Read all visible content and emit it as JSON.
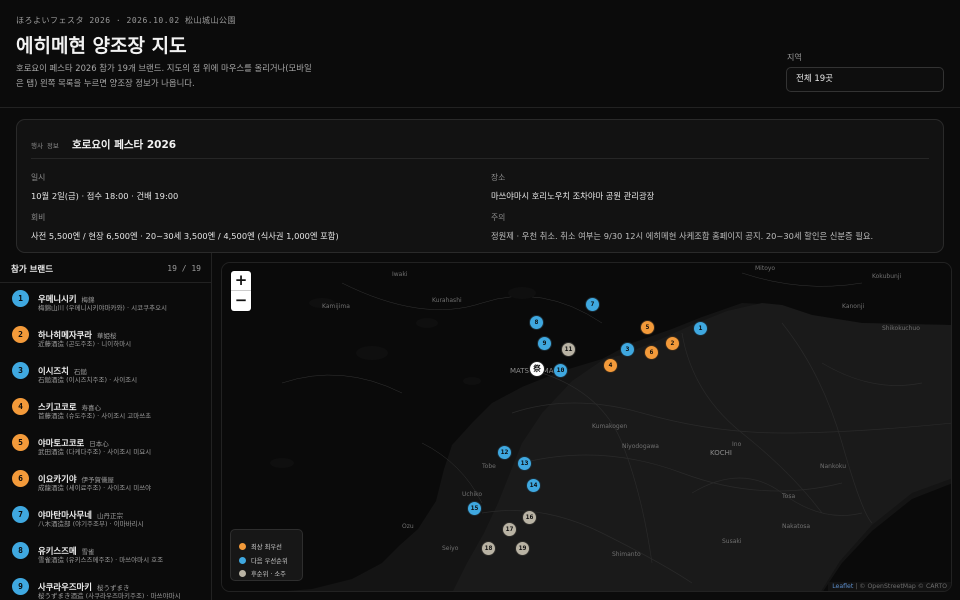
{
  "header": {
    "eyebrow": "ほろよいフェスタ 2026 · 2026.10.02 松山城山公園",
    "title": "에히메현 양조장 지도",
    "subtitle": "호로요이 페스타 2026 참가 19개 브랜드. 지도의 점 위에 마우스를 올리거나(모바일은 탭) 왼쪽 목록을 누르면 양조장 정보가 나옵니다.",
    "region_label": "지역",
    "region_value": "전체 19곳"
  },
  "event": {
    "kicker": "행사 정보",
    "title": "호로요이 페스타 2026",
    "fields": [
      {
        "label": "일시",
        "value": "10월 2일(금) · 접수 18:00 · 건배 19:00"
      },
      {
        "label": "장소",
        "value": "마쓰야마시 호리노우치 조차야마 공원 관리광장"
      },
      {
        "label": "회비",
        "value": "사전 5,500엔 / 현장 6,500엔 · 20~30세 3,500엔 / 4,500엔 (식사권 1,000엔 포함)"
      },
      {
        "label": "주의",
        "value": "정원제 · 우천 취소. 취소 여부는 9/30 12시 에히메현 사케조합 홈페이지 공지. 20~30세 할인은 신분증 필요."
      }
    ]
  },
  "sidebar": {
    "title": "참가 브랜드",
    "count": "19 / 19",
    "brands": [
      {
        "num": "1",
        "name": "우메니시키",
        "jp": "梅錦",
        "detail": "梅錦山川 (우메니시키야마카와) · 시코쿠추오시",
        "group": "blue"
      },
      {
        "num": "2",
        "name": "하나히메자쿠라",
        "jp": "華姫桜",
        "detail": "近藤酒造 (곤도주조) · 니이하마시",
        "group": "orange"
      },
      {
        "num": "3",
        "name": "이시즈치",
        "jp": "石鎚",
        "detail": "石鎚酒造 (이시즈치주조) · 사이조시",
        "group": "blue"
      },
      {
        "num": "4",
        "name": "스키고코로",
        "jp": "寿喜心",
        "detail": "首藤酒造 (슈도주조) · 사이조시 고마쓰초",
        "group": "orange"
      },
      {
        "num": "5",
        "name": "야마토고코로",
        "jp": "日本心",
        "detail": "武田酒造 (다케다주조) · 사이조시 미요시",
        "group": "orange"
      },
      {
        "num": "6",
        "name": "이요카기야",
        "jp": "伊予賀儀屋",
        "detail": "成龍酒造 (세이료주조) · 사이조시 미쓰야",
        "group": "orange"
      },
      {
        "num": "7",
        "name": "야마탄마사무네",
        "jp": "山丹正宗",
        "detail": "八木酒造部 (야기주조부) · 이마바리시",
        "group": "blue"
      },
      {
        "num": "8",
        "name": "유키스즈메",
        "jp": "雪雀",
        "detail": "雪雀酒造 (유키스즈메주조) · 마쓰야마시 호조",
        "group": "blue"
      },
      {
        "num": "9",
        "name": "사쿠라우즈마키",
        "jp": "桜うずまき",
        "detail": "桜うずまき酒造 (사쿠라우즈마키주조) · 마쓰야마시",
        "group": "blue"
      }
    ]
  },
  "map": {
    "zoom_in": "+",
    "zoom_out": "−",
    "venue_label": "祭",
    "colors": {
      "orange": "#f39a3a",
      "blue": "#3fa8e0",
      "gray": "#b9b3a4"
    },
    "markers": [
      {
        "num": "1",
        "group": "blue"
      },
      {
        "num": "2",
        "group": "orange"
      },
      {
        "num": "3",
        "group": "blue"
      },
      {
        "num": "4",
        "group": "orange"
      },
      {
        "num": "5",
        "group": "orange"
      },
      {
        "num": "6",
        "group": "orange"
      },
      {
        "num": "7",
        "group": "blue"
      },
      {
        "num": "8",
        "group": "blue"
      },
      {
        "num": "9",
        "group": "blue"
      },
      {
        "num": "10",
        "group": "blue"
      },
      {
        "num": "11",
        "group": "gray"
      },
      {
        "num": "12",
        "group": "blue"
      },
      {
        "num": "13",
        "group": "blue"
      },
      {
        "num": "14",
        "group": "blue"
      },
      {
        "num": "15",
        "group": "blue"
      },
      {
        "num": "16",
        "group": "gray"
      },
      {
        "num": "17",
        "group": "gray"
      },
      {
        "num": "18",
        "group": "gray"
      },
      {
        "num": "19",
        "group": "gray"
      }
    ],
    "place_labels": [
      "Mitoyo",
      "Iwaki",
      "Kurahashi",
      "Kamijima",
      "Kokubunji",
      "Kanonji",
      "Shikokuchuo",
      "MATSUYAMA",
      "Kumakogen",
      "Tobe",
      "Niyodogawa",
      "Ino",
      "KOCHI",
      "Nankoku",
      "Tosa",
      "Susaki",
      "Nakatosa",
      "Uchiko",
      "Ozu",
      "Seiyo",
      "Shimanto"
    ],
    "legend": [
      {
        "label": "최상 최우선",
        "group": "orange"
      },
      {
        "label": "다음 우선순위",
        "group": "blue"
      },
      {
        "label": "후순위 · 소주",
        "group": "gray"
      }
    ],
    "attribution": {
      "leaflet": "Leaflet",
      "rest": "| © OpenStreetMap © CARTO"
    }
  }
}
